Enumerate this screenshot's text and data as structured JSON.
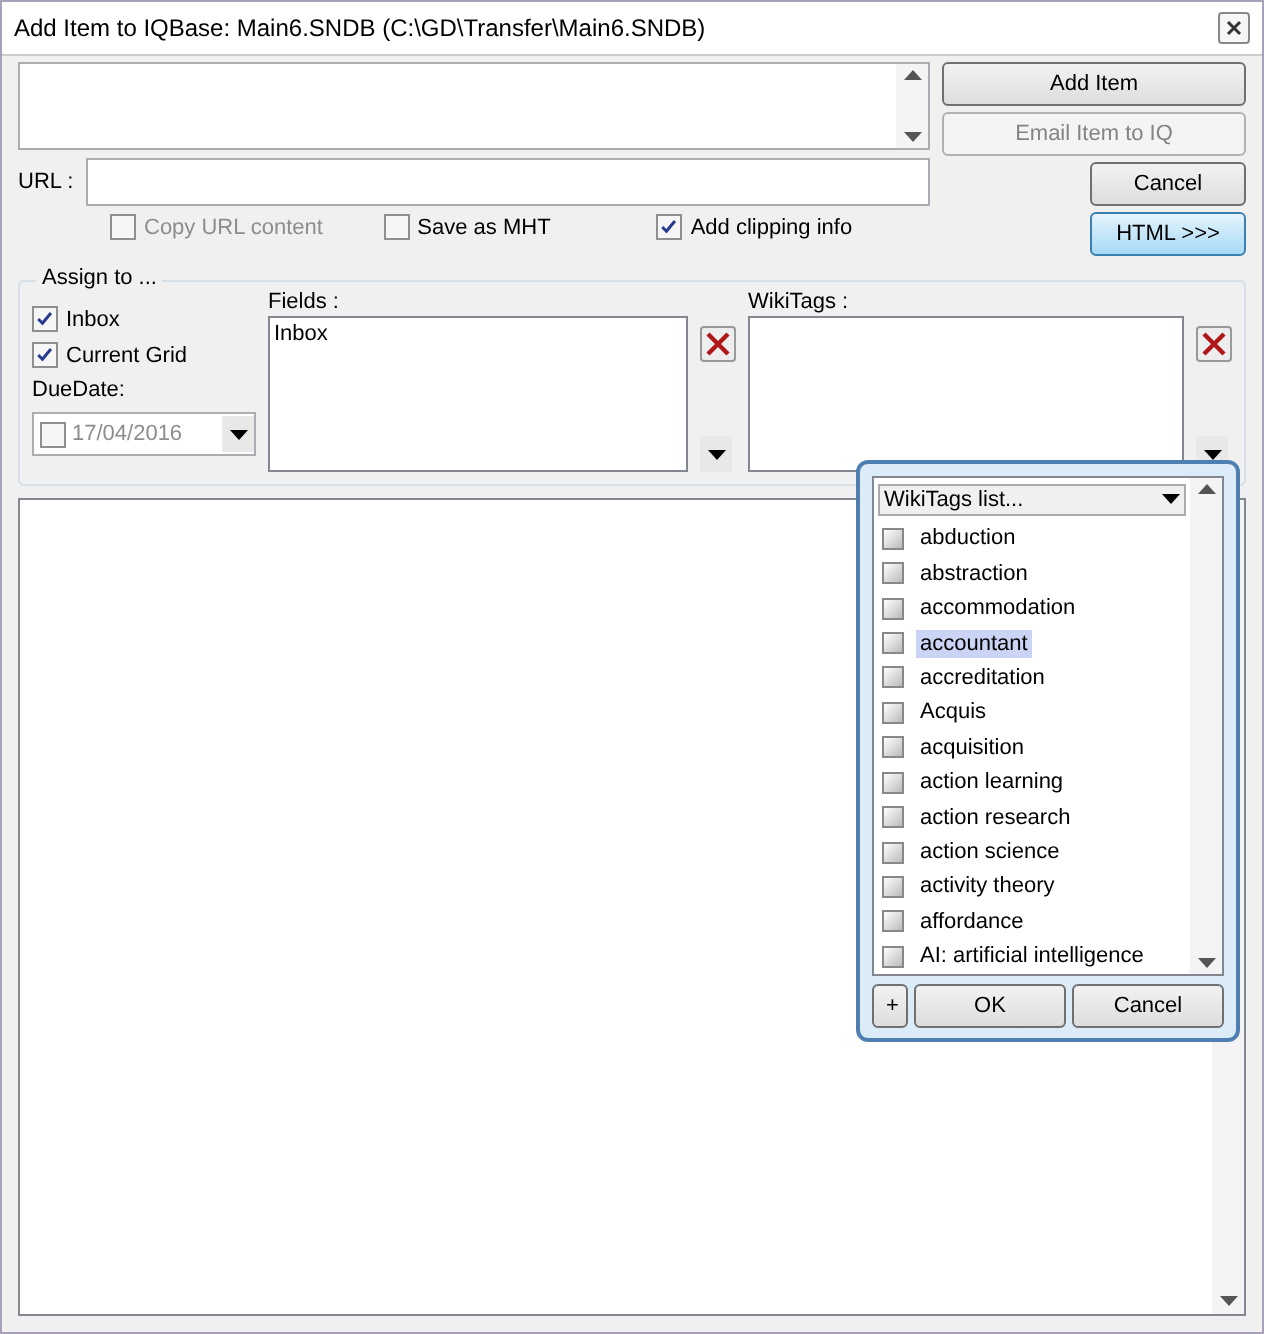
{
  "window": {
    "title": "Add Item to IQBase: Main6.SNDB (C:\\GD\\Transfer\\Main6.SNDB)"
  },
  "buttons": [
    {
      "label": "Add Item",
      "disabled": false,
      "kind": "normal"
    },
    {
      "label": "Email Item to IQ",
      "disabled": true,
      "kind": "normal"
    },
    {
      "label": "Cancel",
      "disabled": false,
      "kind": "normal"
    },
    {
      "label": "HTML >>>",
      "disabled": false,
      "kind": "accent"
    }
  ],
  "url": {
    "label": "URL :"
  },
  "options": [
    {
      "label": "Copy URL content",
      "checked": false,
      "disabled": true
    },
    {
      "label": "Save as MHT",
      "checked": false,
      "disabled": false
    },
    {
      "label": "Add clipping info",
      "checked": true,
      "disabled": false
    }
  ],
  "assign": {
    "title": "Assign to ...",
    "checks": [
      {
        "label": "Inbox",
        "checked": true
      },
      {
        "label": "Current Grid",
        "checked": true
      }
    ],
    "due_label": "DueDate:",
    "due_checked": false,
    "due_value": "17/04/2016"
  },
  "fields": {
    "label": "Fields :",
    "items": [
      "Inbox"
    ]
  },
  "wikitags": {
    "label": "WikiTags :"
  },
  "popup": {
    "header": "WikiTags list...",
    "items": [
      {
        "label": "abduction",
        "selected": false
      },
      {
        "label": "abstraction",
        "selected": false
      },
      {
        "label": "accommodation",
        "selected": false
      },
      {
        "label": "accountant",
        "selected": true
      },
      {
        "label": "accreditation",
        "selected": false
      },
      {
        "label": "Acquis",
        "selected": false
      },
      {
        "label": "acquisition",
        "selected": false
      },
      {
        "label": "action learning",
        "selected": false
      },
      {
        "label": "action research",
        "selected": false
      },
      {
        "label": "action science",
        "selected": false
      },
      {
        "label": "activity theory",
        "selected": false
      },
      {
        "label": "affordance",
        "selected": false
      },
      {
        "label": "AI: artificial intelligence",
        "selected": false
      }
    ],
    "buttons": [
      "+",
      "OK",
      "Cancel"
    ]
  }
}
